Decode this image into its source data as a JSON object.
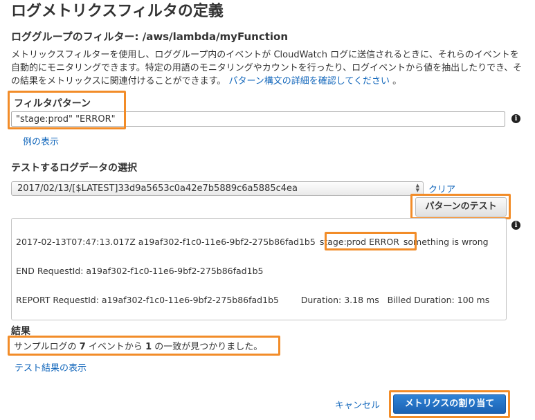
{
  "page_title": "ログメトリクスフィルタの定義",
  "subtitle": "ロググループのフィルター: /aws/lambda/myFunction",
  "description": {
    "text": "メトリックスフィルターを使用し、ロググループ内のイベントが CloudWatch ログに送信されるときに、それらのイベントを自動的にモニタリングできます。特定の用語のモニタリングやカウントを行ったり、ログイベントから値を抽出したりでき、その結果をメトリックスに関連付けることができます。",
    "link_text": "パターン構文の詳細を確認してください",
    "suffix": "。"
  },
  "filter_pattern": {
    "label": "フィルタパターン",
    "value": "\"stage:prod\" \"ERROR\"",
    "examples_link": "例の表示"
  },
  "test_data": {
    "label": "テストするログデータの選択",
    "selected_stream": "2017/02/13/[$LATEST]33d9a5653c0a42e7b5889c6a5885c4ea",
    "clear_link": "クリア",
    "test_button": "パターンのテスト"
  },
  "log_lines": {
    "line1_prefix": "2017-02-13T07:47:13.017Z  a19af302-f1c0-11e6-9bf2-275b86fad1b5",
    "line1_match": "stage:prod ERROR",
    "line1_suffix": "something is wrong",
    "line2": "END RequestId: a19af302-f1c0-11e6-9bf2-275b86fad1b5",
    "line3": "REPORT RequestId: a19af302-f1c0-11e6-9bf2-275b86fad1b5        Duration: 3.18 ms   Billed Duration: 100 ms"
  },
  "results": {
    "label": "結果",
    "text_prefix": "サンプルログの ",
    "event_count": "7",
    "text_middle": " イベントから ",
    "match_count": "1",
    "text_suffix": " の一致が見つかりました。",
    "show_results_link": "テスト結果の表示"
  },
  "footer": {
    "cancel_link": "キャンセル",
    "assign_button": "メトリクスの割り当て"
  },
  "icons": {
    "info": "info-icon",
    "select_arrows": "updown-arrows-icon"
  },
  "colors": {
    "highlight": "#f28c28",
    "link": "#1166bb",
    "primary": "#1f6dc2"
  }
}
